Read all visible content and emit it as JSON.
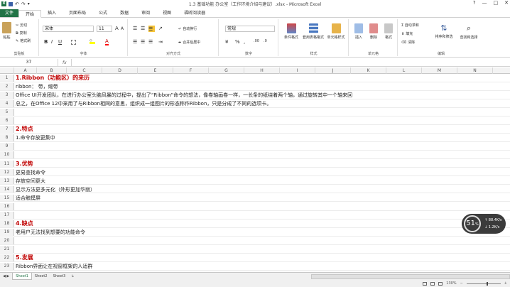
{
  "window": {
    "title": "1.3 基础功能 办公室（工作环境介绍与建议）.xlsx - Microsoft Excel",
    "controls": [
      "?",
      "—",
      "□",
      "✕"
    ]
  },
  "tabs": [
    "文件",
    "开始",
    "插入",
    "页面布局",
    "公式",
    "数据",
    "审阅",
    "视图",
    "福昕阅读器"
  ],
  "ribbon": {
    "clipboard": {
      "paste": "粘贴",
      "cut": "剪切",
      "copy": "复制",
      "format_painter": "格式刷",
      "label": "剪贴板"
    },
    "font": {
      "name": "宋体",
      "size": "11",
      "bold": "B",
      "italic": "I",
      "underline": "U",
      "grow": "A",
      "shrink": "A",
      "label": "字体"
    },
    "alignment": {
      "wrap": "自动换行",
      "merge": "合并后居中",
      "label": "对齐方式"
    },
    "number": {
      "format": "常规",
      "percent": "%",
      "comma": ",",
      "label": "数字"
    },
    "styles": {
      "conditional": "条件格式",
      "table": "套用表格格式",
      "cell": "单元格样式",
      "label": "样式"
    },
    "cells": {
      "insert": "插入",
      "delete": "删除",
      "format": "格式",
      "label": "单元格"
    },
    "editing": {
      "sum": "Σ 自动求和",
      "fill": "填充",
      "clear": "清除",
      "sort": "排序和筛选",
      "find": "查找和选择",
      "label": "编辑"
    }
  },
  "formula_bar": {
    "name_box": "37",
    "fx": "fx",
    "content": ""
  },
  "columns": [
    "A",
    "B",
    "C",
    "D",
    "E",
    "F",
    "G",
    "H",
    "I",
    "J",
    "K",
    "L",
    "M",
    "N"
  ],
  "rows": [
    {
      "n": "1",
      "text": "1.Ribbon（功能区）的来历",
      "style": "red"
    },
    {
      "n": "2",
      "text": " ribbon：    带，缎带",
      "style": ""
    },
    {
      "n": "3",
      "text": "Office UI开发团队，在进行办公室头脑风暴的过程中，提出了“Ribbon”命令的想法，像卷轴画卷一样，一长条的纸绕着两个轴，通过旋转其中一个轴来回",
      "style": ""
    },
    {
      "n": "4",
      "text": "总之，在Office 12中采用了与Ribbon相同的意思，组织成一组图片的形态称作Ribbon，只是分成了不同的选项卡。",
      "style": ""
    },
    {
      "n": "5",
      "text": "",
      "style": ""
    },
    {
      "n": "6",
      "text": "",
      "style": ""
    },
    {
      "n": "7",
      "text": "2.特点",
      "style": "red"
    },
    {
      "n": "8",
      "text": "1.命令存放更集中",
      "style": ""
    },
    {
      "n": "9",
      "text": "",
      "style": ""
    },
    {
      "n": "10",
      "text": "",
      "style": ""
    },
    {
      "n": "11",
      "text": "3.优势",
      "style": "red"
    },
    {
      "n": "12",
      "text": "更易查找命令",
      "style": ""
    },
    {
      "n": "13",
      "text": "存放空间更大",
      "style": ""
    },
    {
      "n": "14",
      "text": "显示方法更多元化（外形更加华丽）",
      "style": ""
    },
    {
      "n": "15",
      "text": "适合触摸屏",
      "style": ""
    },
    {
      "n": "16",
      "text": "",
      "style": ""
    },
    {
      "n": "17",
      "text": "",
      "style": ""
    },
    {
      "n": "18",
      "text": "4.缺点",
      "style": "red"
    },
    {
      "n": "19",
      "text": "老用户无法找到想要的功能命令",
      "style": ""
    },
    {
      "n": "20",
      "text": "",
      "style": ""
    },
    {
      "n": "21",
      "text": "",
      "style": ""
    },
    {
      "n": "22",
      "text": "5.发展",
      "style": "red"
    },
    {
      "n": "23",
      "text": "Ribbon界面让在视窗框架的人适群",
      "style": ""
    }
  ],
  "sheets": {
    "nav": "◀ ▶",
    "tabs": [
      "Sheet1",
      "Sheet2",
      "Sheet3"
    ],
    "new": "↳"
  },
  "status": {
    "zoom": "130%",
    "zoom_minus": "−",
    "zoom_plus": "+"
  },
  "overlay": {
    "percent": "51",
    "unit": "%",
    "up": "88.4K/s",
    "down": "1.2K/s"
  }
}
